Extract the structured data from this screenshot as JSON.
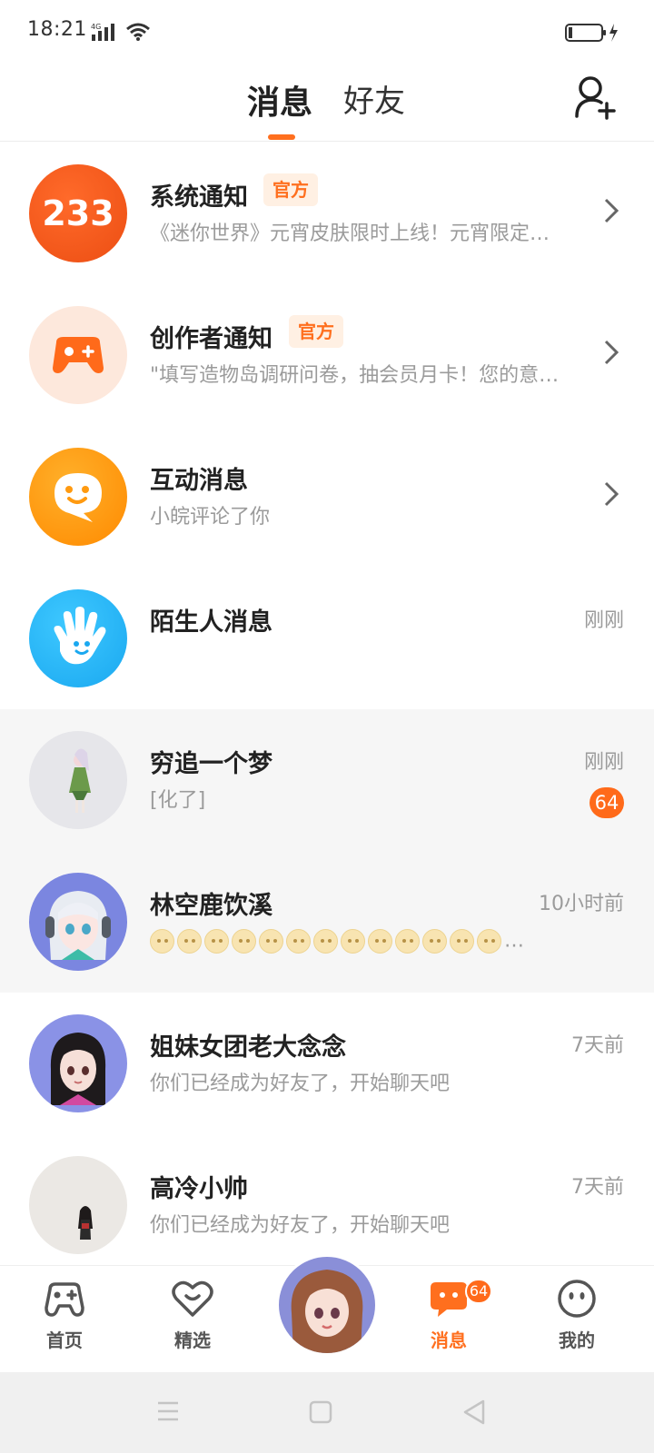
{
  "status_bar": {
    "time": "18:21",
    "network": "4G"
  },
  "header": {
    "tab_messages": "消息",
    "tab_friends": "好友"
  },
  "colors": {
    "accent": "#ff6f1e",
    "badge_bg": "#fff0e3",
    "muted": "#9b9b9b"
  },
  "conversations": [
    {
      "title": "系统通知",
      "badge": "官方",
      "preview": "《迷你世界》元宵皮肤限时上线！元宵限定…",
      "icon": "233-logo-icon"
    },
    {
      "title": "创作者通知",
      "badge": "官方",
      "preview": "\"填写造物岛调研问卷，抽会员月卡！您的意…",
      "icon": "gamepad-icon"
    },
    {
      "title": "互动消息",
      "preview": "小皖评论了你",
      "icon": "chat-smile-icon"
    },
    {
      "title": "陌生人消息",
      "time": "刚刚",
      "icon": "hand-wave-icon"
    },
    {
      "title": "穷追一个梦",
      "preview": "[化了]",
      "time": "刚刚",
      "unread": "64"
    },
    {
      "title": "林空鹿饮溪",
      "preview": "…",
      "time": "10小时前"
    },
    {
      "title": "姐妹女团老大念念",
      "preview": "你们已经成为好友了，开始聊天吧",
      "time": "7天前"
    },
    {
      "title": "高冷小帅",
      "preview": "你们已经成为好友了，开始聊天吧",
      "time": "7天前"
    }
  ],
  "bottom_nav": {
    "home": "首页",
    "featured": "精选",
    "messages": "消息",
    "messages_badge": "64",
    "mine": "我的"
  }
}
